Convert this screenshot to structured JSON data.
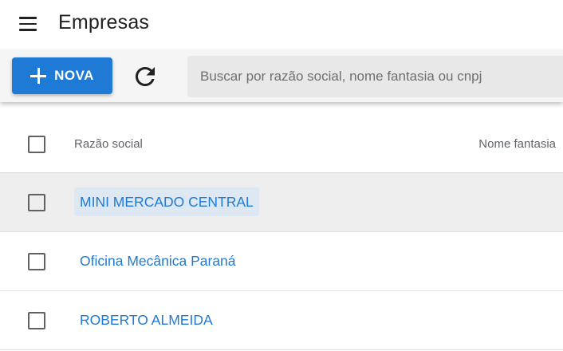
{
  "header": {
    "title": "Empresas",
    "menu_icon": "hamburger-menu-icon"
  },
  "toolbar": {
    "new_label": "NOVA",
    "new_icon": "plus-icon",
    "refresh_icon": "refresh-icon",
    "search_placeholder": "Buscar por razão social, nome fantasia ou cnpj",
    "search_value": ""
  },
  "table": {
    "columns": [
      "Razão social",
      "Nome fantasia"
    ],
    "rows": [
      {
        "razao_social": "MINI MERCADO CENTRAL",
        "nome_fantasia": "",
        "highlighted": true,
        "checked": false
      },
      {
        "razao_social": "Oficina Mecânica Paraná",
        "nome_fantasia": "",
        "highlighted": false,
        "checked": false
      },
      {
        "razao_social": "ROBERTO ALMEIDA",
        "nome_fantasia": "",
        "highlighted": false,
        "checked": false
      }
    ]
  },
  "colors": {
    "accent": "#1f7ad6",
    "toolbar_bg": "#f5f5f5",
    "search_bg": "#e8e8e8",
    "row_highlight": "#eeeeee"
  }
}
